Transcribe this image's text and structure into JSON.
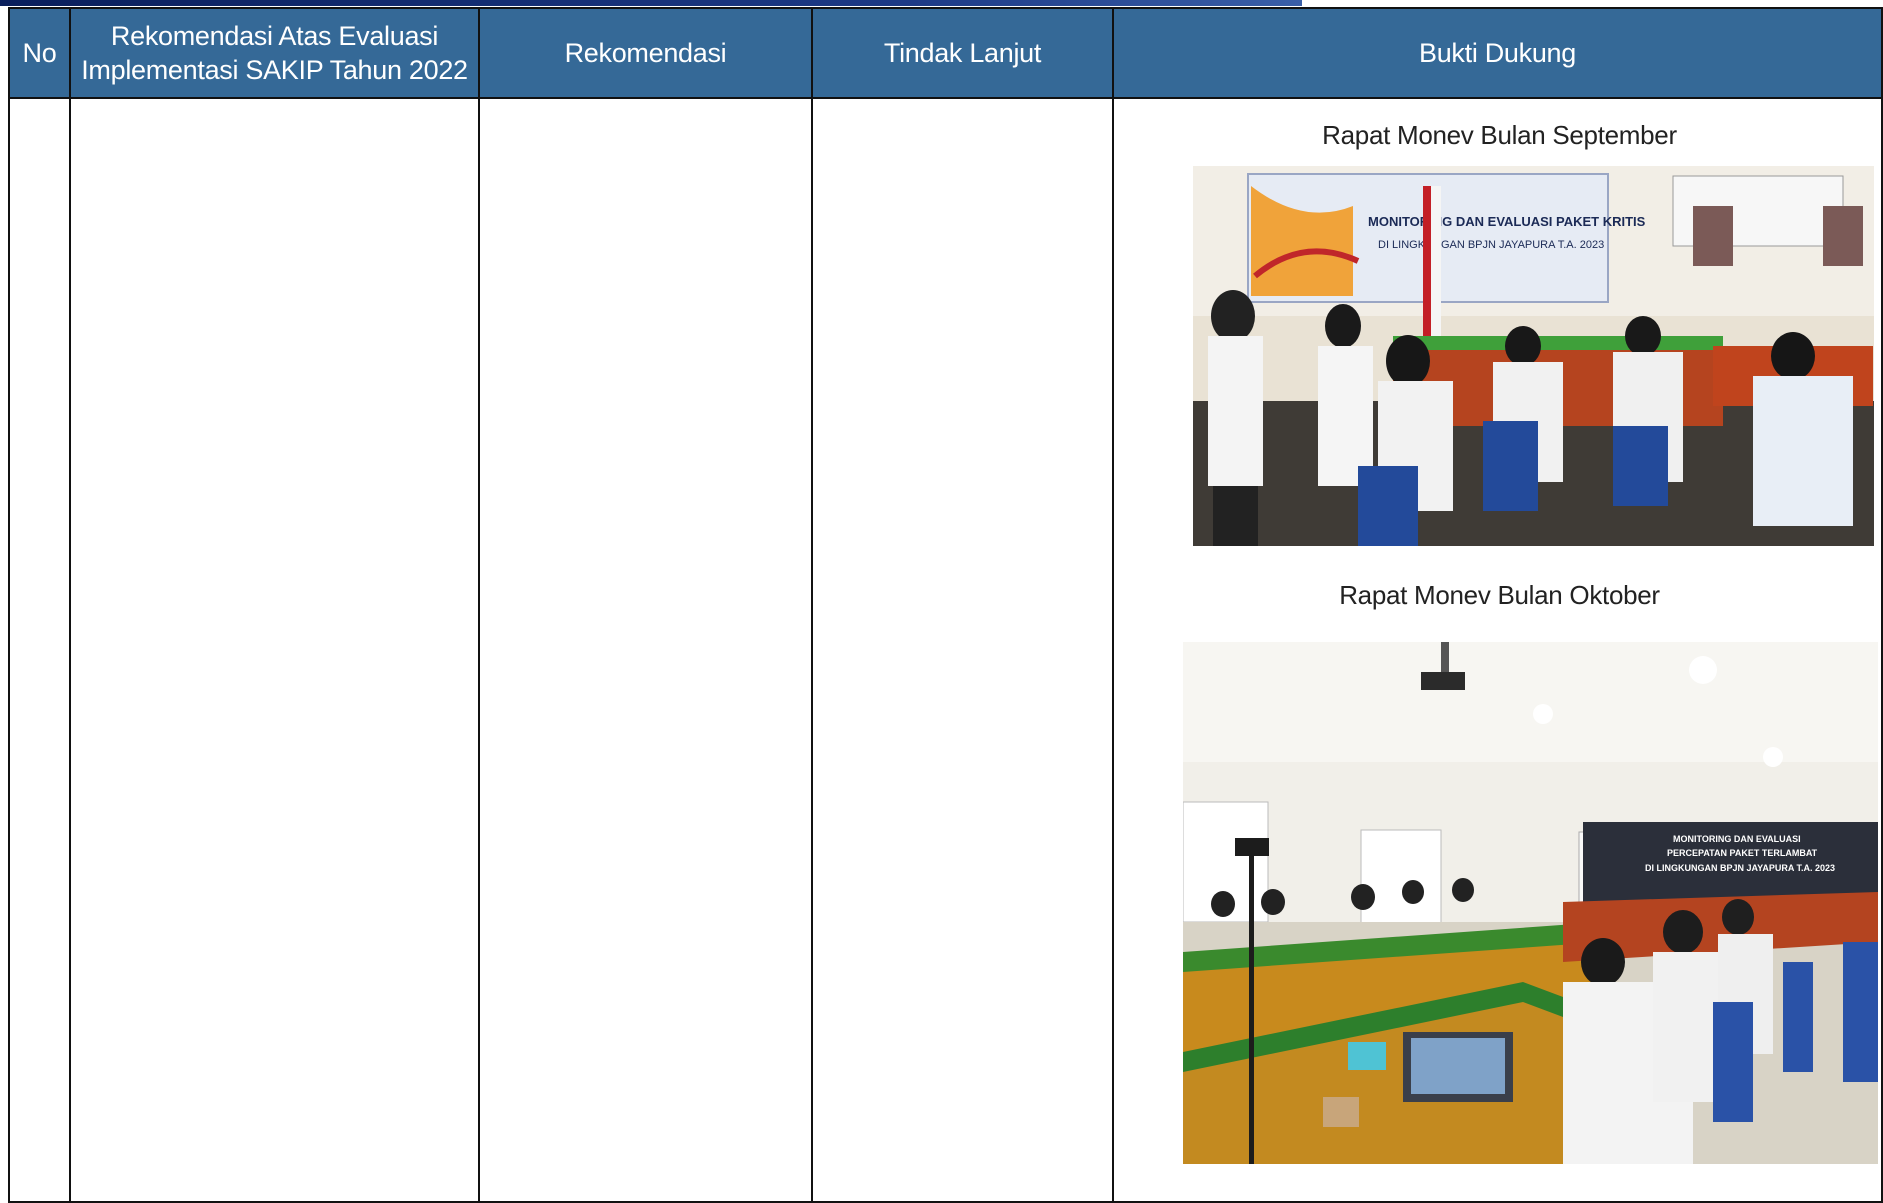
{
  "table": {
    "headers": {
      "no": "No",
      "rekomendasi_evaluasi": "Rekomendasi Atas Evaluasi Implementasi SAKIP Tahun 2022",
      "rekomendasi": "Rekomendasi",
      "tindak_lanjut": "Tindak Lanjut",
      "bukti_dukung": "Bukti Dukung"
    },
    "row": {
      "no": "",
      "rekomendasi_evaluasi": "",
      "rekomendasi": "",
      "tindak_lanjut": "",
      "bukti_dukung": [
        {
          "caption": "Rapat Monev Bulan September",
          "banner_line1": "MONITORING DAN EVALUASI PAKET KRITIS",
          "banner_line2": "DI LINGKUNGAN BPJN JAYAPURA T.A. 2023"
        },
        {
          "caption": "Rapat Monev Bulan Oktober",
          "banner_line1": "MONITORING DAN EVALUASI",
          "banner_line2": "PERCEPATAN PAKET TERLAMBAT",
          "banner_line3": "DI LINGKUNGAN BPJN JAYAPURA T.A. 2023"
        }
      ]
    }
  },
  "colors": {
    "header_bg": "#356997",
    "header_text": "#ffffff",
    "border": "#111111",
    "top_band": "#1d3a86"
  }
}
